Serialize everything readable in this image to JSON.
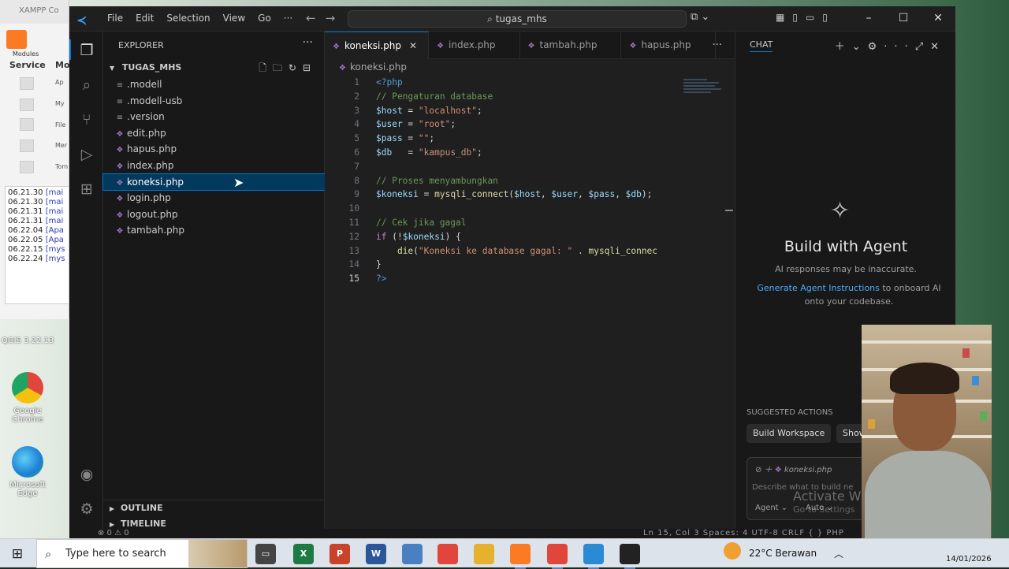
{
  "desktop": {
    "xampp_title": "XAMPP Co",
    "xampp_modules": "Modules",
    "xampp_service": "Service",
    "xampp_mo": "Mo",
    "xampp_side_labels": [
      "Ap",
      "My",
      "File",
      "Mer",
      "Tom"
    ],
    "xampp_log": [
      {
        "time": "06.21.30",
        "tag": "[mai"
      },
      {
        "time": "06.21.30",
        "tag": "[mai"
      },
      {
        "time": "06.21.31",
        "tag": "[mai"
      },
      {
        "time": "06.21.31",
        "tag": "[mai"
      },
      {
        "time": "06.22.04",
        "tag": "[Apa"
      },
      {
        "time": "06.22.05",
        "tag": "[Apa"
      },
      {
        "time": "06.22.15",
        "tag": "[mys"
      },
      {
        "time": "06.22.24",
        "tag": "[mys"
      }
    ],
    "qgis_label": "QGIS 3.22.13",
    "icons": [
      {
        "label": "Google Chrome",
        "name": "google-chrome-desktop-icon"
      },
      {
        "label": "Microsoft Edge",
        "name": "microsoft-edge-desktop-icon"
      }
    ]
  },
  "titlebar": {
    "menus": [
      "File",
      "Edit",
      "Selection",
      "View",
      "Go",
      "···"
    ],
    "search_text": "tugas_mhs"
  },
  "explorer": {
    "header": "EXPLORER",
    "project": "TUGAS_MHS",
    "files": [
      {
        "name": ".modell",
        "type": "plain"
      },
      {
        "name": ".modell-usb",
        "type": "plain"
      },
      {
        "name": ".version",
        "type": "plain"
      },
      {
        "name": "edit.php",
        "type": "php"
      },
      {
        "name": "hapus.php",
        "type": "php"
      },
      {
        "name": "index.php",
        "type": "php"
      },
      {
        "name": "koneksi.php",
        "type": "php",
        "selected": true
      },
      {
        "name": "login.php",
        "type": "php"
      },
      {
        "name": "logout.php",
        "type": "php"
      },
      {
        "name": "tambah.php",
        "type": "php"
      }
    ],
    "outline": "OUTLINE",
    "timeline": "TIMELINE"
  },
  "editor": {
    "tabs": [
      {
        "label": "koneksi.php",
        "active": true
      },
      {
        "label": "index.php",
        "active": false
      },
      {
        "label": "tambah.php",
        "active": false
      },
      {
        "label": "hapus.php",
        "active": false
      }
    ],
    "breadcrumb": "koneksi.php",
    "current_line": 15,
    "lines": [
      [
        {
          "t": "<?php",
          "c": "tag"
        }
      ],
      [
        {
          "t": "// Pengaturan database",
          "c": "cm"
        }
      ],
      [
        {
          "t": "$host",
          "c": "var"
        },
        {
          "t": " = ",
          "c": ""
        },
        {
          "t": "\"localhost\"",
          "c": "str"
        },
        {
          "t": ";",
          "c": ""
        }
      ],
      [
        {
          "t": "$user",
          "c": "var"
        },
        {
          "t": " = ",
          "c": ""
        },
        {
          "t": "\"root\"",
          "c": "str"
        },
        {
          "t": ";",
          "c": ""
        }
      ],
      [
        {
          "t": "$pass",
          "c": "var"
        },
        {
          "t": " = ",
          "c": ""
        },
        {
          "t": "\"\"",
          "c": "str"
        },
        {
          "t": ";",
          "c": ""
        }
      ],
      [
        {
          "t": "$db",
          "c": "var"
        },
        {
          "t": "   = ",
          "c": ""
        },
        {
          "t": "\"kampus_db\"",
          "c": "str"
        },
        {
          "t": ";",
          "c": ""
        }
      ],
      [],
      [
        {
          "t": "// Proses menyambungkan",
          "c": "cm"
        }
      ],
      [
        {
          "t": "$koneksi",
          "c": "var"
        },
        {
          "t": " = ",
          "c": ""
        },
        {
          "t": "mysqli_connect",
          "c": "fn"
        },
        {
          "t": "(",
          "c": ""
        },
        {
          "t": "$host",
          "c": "var"
        },
        {
          "t": ", ",
          "c": ""
        },
        {
          "t": "$user",
          "c": "var"
        },
        {
          "t": ", ",
          "c": ""
        },
        {
          "t": "$pass",
          "c": "var"
        },
        {
          "t": ", ",
          "c": ""
        },
        {
          "t": "$db",
          "c": "var"
        },
        {
          "t": ");",
          "c": ""
        }
      ],
      [],
      [
        {
          "t": "// Cek jika gagal",
          "c": "cm"
        }
      ],
      [
        {
          "t": "if",
          "c": "kw"
        },
        {
          "t": " (!",
          "c": ""
        },
        {
          "t": "$koneksi",
          "c": "var"
        },
        {
          "t": ") {",
          "c": ""
        }
      ],
      [
        {
          "t": "    ",
          "c": ""
        },
        {
          "t": "die",
          "c": "fn"
        },
        {
          "t": "(",
          "c": ""
        },
        {
          "t": "\"Koneksi ke database gagal: \"",
          "c": "str"
        },
        {
          "t": " . ",
          "c": ""
        },
        {
          "t": "mysqli_connec",
          "c": "fn"
        }
      ],
      [
        {
          "t": "}",
          "c": ""
        }
      ],
      [
        {
          "t": "?>",
          "c": "tag"
        }
      ]
    ]
  },
  "chat": {
    "header": "CHAT",
    "title": "Build with Agent",
    "disclaimer": "AI responses may be inaccurate.",
    "link": "Generate Agent Instructions",
    "link_suffix": " to onboard AI onto your codebase.",
    "suggested": "SUGGESTED ACTIONS",
    "actions": [
      "Build Workspace",
      "Show"
    ],
    "context_file": "koneksi.php",
    "placeholder": "Describe what to build ne",
    "mode": "Agent",
    "model": "Auto",
    "watermark": "Activate W",
    "watermark2": "Go to Settings"
  },
  "statusbar": {
    "left": "⊗ 0 ⚠ 0",
    "right": "Ln 15, Col 3   Spaces: 4   UTF-8   CRLF   { } PHP"
  },
  "taskbar": {
    "search_placeholder": "Type here to search",
    "weather": "22°C  Berawan",
    "date": "14/01/2026",
    "apps": [
      {
        "name": "task-view-icon",
        "label": "",
        "color": "#444",
        "glyph": "▭"
      },
      {
        "name": "excel-icon",
        "label": "X",
        "color": "#1d7a45"
      },
      {
        "name": "powerpoint-icon",
        "label": "P",
        "color": "#c8432a"
      },
      {
        "name": "word-icon",
        "label": "W",
        "color": "#2b579a"
      },
      {
        "name": "network-app-icon",
        "label": "",
        "color": "#4a7fc1"
      },
      {
        "name": "chrome-icon",
        "label": "",
        "color": "#e0463b"
      },
      {
        "name": "file-explorer-icon",
        "label": "",
        "color": "#e6b12e"
      },
      {
        "name": "xampp-icon",
        "label": "",
        "color": "#fb7a24"
      },
      {
        "name": "chrome-profile-icon",
        "label": "",
        "color": "#e0463b"
      },
      {
        "name": "vscode-icon",
        "label": "",
        "color": "#2a8ad4"
      },
      {
        "name": "obs-icon",
        "label": "",
        "color": "#222"
      }
    ]
  },
  "colors": {
    "accent": "#0078d4",
    "selection": "#04395e",
    "php_icon": "#a074c4"
  }
}
